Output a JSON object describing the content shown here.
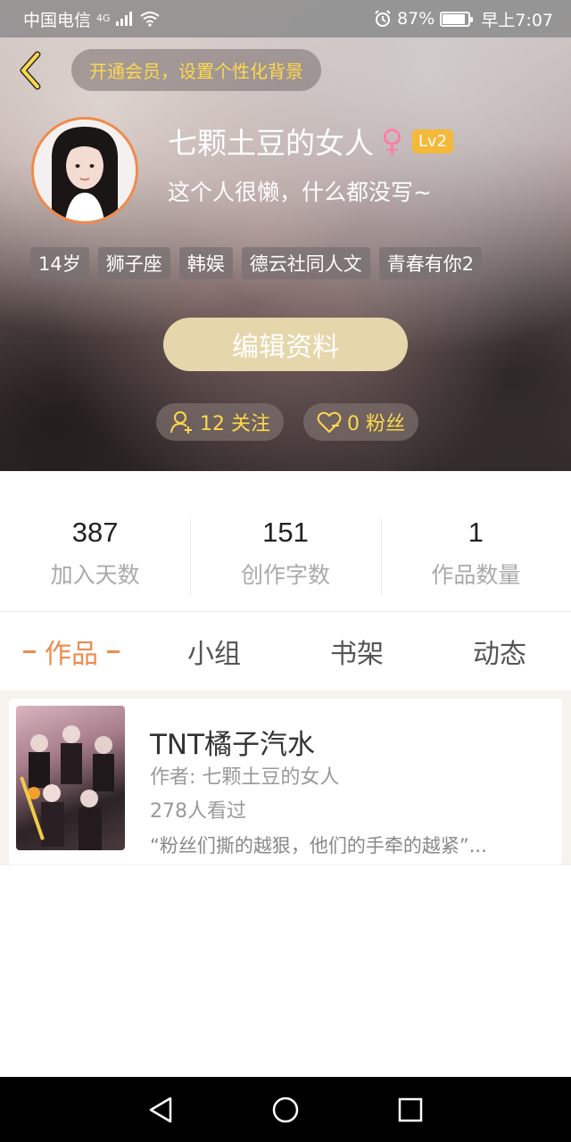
{
  "status_bar": {
    "carrier": "中国电信",
    "network": "4G",
    "battery": "87%",
    "battery_level": 0.87,
    "time": "早上7:07"
  },
  "header": {
    "vip_banner": "开通会员，设置个性化背景"
  },
  "profile": {
    "name": "七颗土豆的女人",
    "gender_symbol": "♀",
    "level": "Lv2",
    "bio": "这个人很懒，什么都没写~",
    "tags": [
      "14岁",
      "狮子座",
      "韩娱",
      "德云社同人文",
      "青春有你2"
    ],
    "edit_button": "编辑资料",
    "following": "12 关注",
    "fans": "0 粉丝"
  },
  "stats": [
    {
      "value": "387",
      "label": "加入天数"
    },
    {
      "value": "151",
      "label": "创作字数"
    },
    {
      "value": "1",
      "label": "作品数量"
    }
  ],
  "tabs": [
    {
      "label": "作品",
      "active": true
    },
    {
      "label": "小组",
      "active": false
    },
    {
      "label": "书架",
      "active": false
    },
    {
      "label": "动态",
      "active": false
    }
  ],
  "works": [
    {
      "title": "TNT橘子汽水",
      "author": "作者: 七颗土豆的女人",
      "views": "278人看过",
      "desc": "“粉丝们撕的越狠，他们的手牵的越紧”..."
    }
  ],
  "colors": {
    "accent": "#f08a4b",
    "gold": "#ffd84a",
    "edit_button": "#e6d6ab",
    "level_badge": "#f5b93a"
  }
}
